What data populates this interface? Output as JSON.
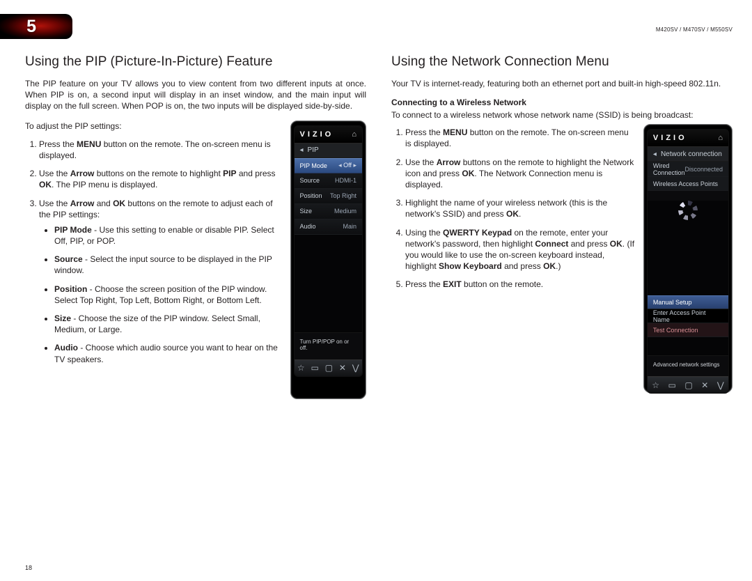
{
  "page": {
    "chapter_number": "5",
    "model_line": "M420SV / M470SV / M550SV",
    "page_number": "18"
  },
  "left": {
    "heading": "Using the PIP (Picture-In-Picture) Feature",
    "intro": "The PIP feature on your TV allows you to view content from two different inputs at once. When PIP is on, a second input will display in an inset window, and the main input will display on the full screen. When POP is on, the two inputs will be displayed side-by-side.",
    "lead": "To adjust the PIP settings:",
    "steps": {
      "s1a": "Press the ",
      "s1b": "MENU",
      "s1c": " button on the remote. The on-screen menu is displayed.",
      "s2a": "Use the ",
      "s2b": "Arrow",
      "s2c": " buttons on the remote to highlight ",
      "s2d": "PIP",
      "s2e": " and press ",
      "s2f": "OK",
      "s2g": ". The PIP menu is displayed.",
      "s3a": "Use the ",
      "s3b": "Arrow",
      "s3c": " and ",
      "s3d": "OK",
      "s3e": " buttons on the remote to adjust each of the PIP settings:"
    },
    "bullets": {
      "b1a": "PIP Mode",
      "b1b": " - Use this setting to enable or disable PIP. Select Off, PIP, or POP.",
      "b2a": "Source",
      "b2b": " - Select the input source to be displayed in the PIP window.",
      "b3a": "Position",
      "b3b": " - Choose the screen position of the PIP window. Select Top Right, Top Left, Bottom Right, or Bottom Left.",
      "b4a": "Size",
      "b4b": " - Choose the size of the PIP window. Select Small, Medium, or Large.",
      "b5a": "Audio",
      "b5b": " - Choose which audio source you want to hear on the TV speakers."
    }
  },
  "right": {
    "heading": "Using the Network Connection Menu",
    "intro": "Your TV is internet-ready, featuring both an ethernet port and built-in high-speed 802.11n.",
    "subhead": "Connecting to a Wireless Network",
    "sublead": "To connect to a wireless network whose network name (SSID) is being broadcast:",
    "steps": {
      "s1a": "Press the ",
      "s1b": "MENU",
      "s1c": " button on the remote. The on-screen menu is displayed.",
      "s2a": "Use the ",
      "s2b": "Arrow",
      "s2c": " buttons on the remote to highlight the Network icon and press ",
      "s2d": "OK",
      "s2e": ". The Network Connection menu is displayed.",
      "s3a": "Highlight the name of your wireless network (this is the network's SSID) and press ",
      "s3b": "OK",
      "s3c": ".",
      "s4a": "Using the ",
      "s4b": "QWERTY Keypad",
      "s4c": " on the remote, enter your network's password, then highlight ",
      "s4d": "Connect",
      "s4e": " and press ",
      "s4f": "OK",
      "s4g": ". (If you would like to use the on-screen keyboard instead, highlight ",
      "s4h": "Show Keyboard",
      "s4i": " and press ",
      "s4j": "OK",
      "s4k": ".)",
      "s5a": "Press the ",
      "s5b": "EXIT",
      "s5c": " button on the remote."
    }
  },
  "device_pip": {
    "logo": "VIZIO",
    "home": "⌂",
    "back": "◂",
    "crumb": "PIP",
    "rows": {
      "r1l": "PIP Mode",
      "r1v": "Off",
      "r2l": "Source",
      "r2v": "HDMI-1",
      "r3l": "Position",
      "r3v": "Top Right",
      "r4l": "Size",
      "r4v": "Medium",
      "r5l": "Audio",
      "r5v": "Main"
    },
    "arrows": "◂ ",
    "arrows2": " ▸",
    "hint": "Turn PIP/POP on or off.",
    "nav": {
      "a": "☆",
      "b": "▭",
      "c": "▢",
      "d": "✕",
      "e": "⋁"
    }
  },
  "device_net": {
    "logo": "VIZIO",
    "home": "⌂",
    "back": "◂",
    "crumb": "Network connection",
    "wired_l": "Wired Connection",
    "wired_v": "Disconnected",
    "wap": "Wireless Access Points",
    "manual": "Manual Setup",
    "enter_ap": "Enter Access Point Name",
    "test": "Test Connection",
    "adv": "Advanced network settings",
    "nav": {
      "a": "☆",
      "b": "▭",
      "c": "▢",
      "d": "✕",
      "e": "⋁"
    }
  }
}
